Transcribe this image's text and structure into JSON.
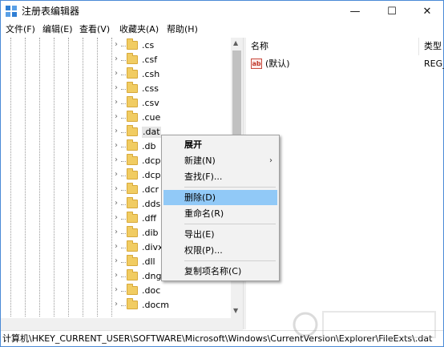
{
  "window": {
    "title": "注册表编辑器",
    "min_glyph": "—",
    "max_glyph": "☐",
    "close_glyph": "✕"
  },
  "menu": [
    "文件(F)",
    "编辑(E)",
    "查看(V)",
    "收藏夹(A)",
    "帮助(H)"
  ],
  "tree": {
    "items": [
      ".cs",
      ".csf",
      ".csh",
      ".css",
      ".csv",
      ".cue",
      ".dat",
      ".db",
      ".dcp",
      ".dcp",
      ".dcr",
      ".dds",
      ".dff",
      ".dib",
      ".divx",
      ".dll",
      ".dng",
      ".doc",
      ".docm"
    ],
    "selected": ".dat"
  },
  "list": {
    "col_name": "名称",
    "col_type": "类型",
    "value_icon": "ab",
    "value_name": "(默认)",
    "value_type": "REG_"
  },
  "context_menu": {
    "expand": "展开",
    "new": "新建(N)",
    "find": "查找(F)...",
    "delete": "删除(D)",
    "rename": "重命名(R)",
    "export": "导出(E)",
    "permissions": "权限(P)...",
    "copy_key_name": "复制项名称(C)"
  },
  "status": {
    "path": "计算机\\HKEY_CURRENT_USER\\SOFTWARE\\Microsoft\\Windows\\CurrentVersion\\Explorer\\FileExts\\.dat"
  },
  "colors": {
    "window_border": "#4a8ad6",
    "menu_highlight": "#91c9f7",
    "folder": "#f1cc62"
  }
}
